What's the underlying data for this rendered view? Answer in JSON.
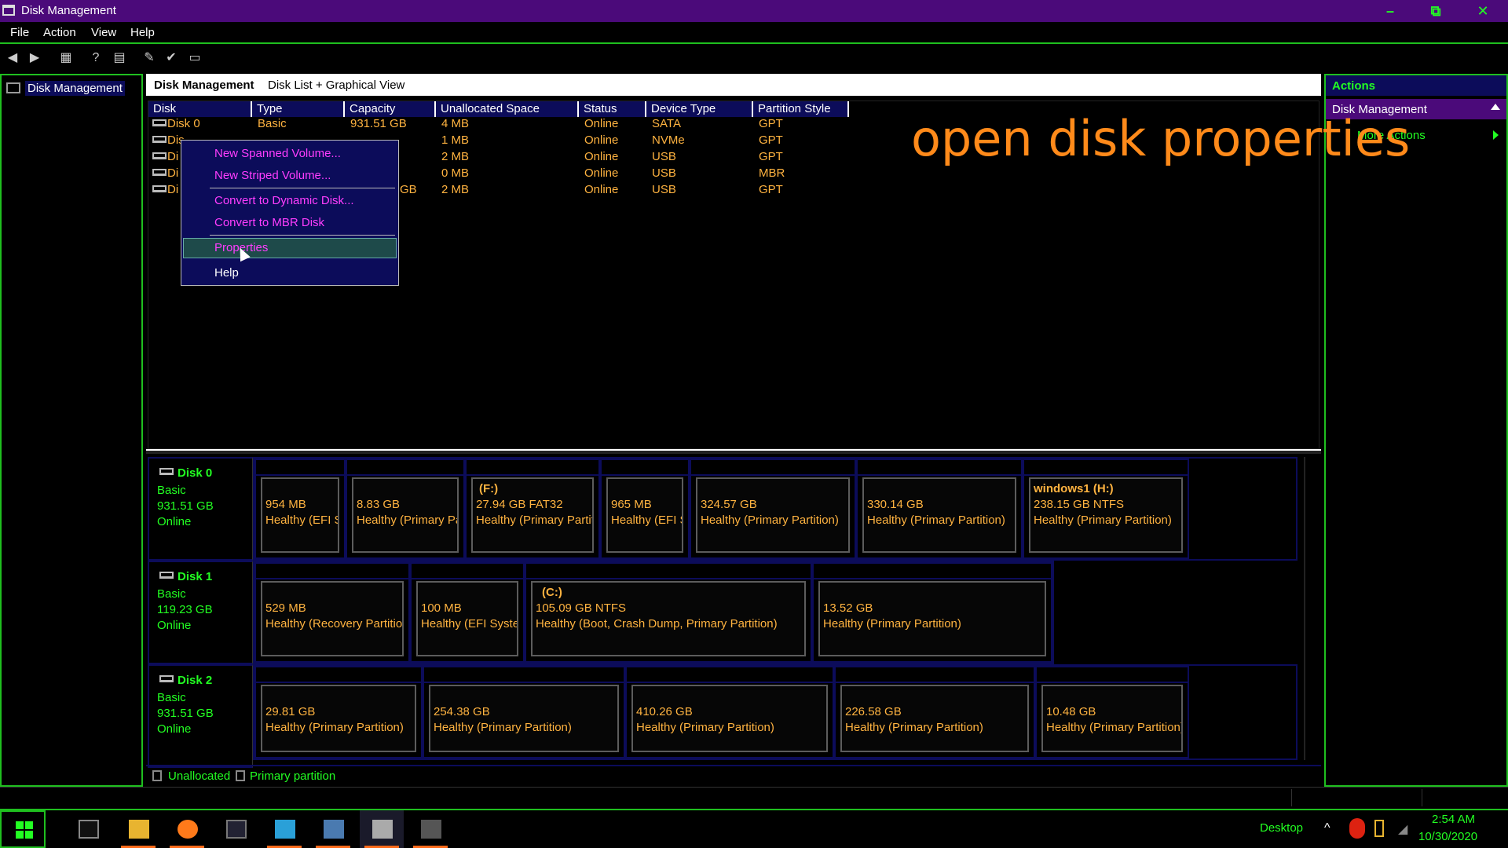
{
  "window": {
    "title": "Disk Management",
    "min": "–",
    "max": "⧉",
    "close": "✕"
  },
  "menu": [
    "File",
    "Action",
    "View",
    "Help"
  ],
  "tree": {
    "root": "Disk Management"
  },
  "center": {
    "title": "Disk Management",
    "view": "Disk List + Graphical View"
  },
  "list": {
    "headers": [
      "Disk",
      "Type",
      "Capacity",
      "Unallocated Space",
      "Status",
      "Device Type",
      "Partition Style"
    ],
    "rows": [
      {
        "disk": "Disk 0",
        "type": "Basic",
        "capacity": "931.51 GB",
        "unalloc": "4 MB",
        "status": "Online",
        "device": "SATA",
        "style": "GPT"
      },
      {
        "disk": "Dis",
        "type": "",
        "capacity": "",
        "unalloc": "1 MB",
        "status": "Online",
        "device": "NVMe",
        "style": "GPT"
      },
      {
        "disk": "Di",
        "type": "",
        "capacity": "",
        "unalloc": "2 MB",
        "status": "Online",
        "device": "USB",
        "style": "GPT"
      },
      {
        "disk": "Di",
        "type": "",
        "capacity": "",
        "unalloc": "0 MB",
        "status": "Online",
        "device": "USB",
        "style": "MBR"
      },
      {
        "disk": "Di",
        "type": "",
        "capacity": "GB",
        "unalloc": "2 MB",
        "status": "Online",
        "device": "USB",
        "style": "GPT"
      }
    ]
  },
  "context_menu": {
    "items": [
      "New Spanned Volume...",
      "New Striped Volume...",
      "Convert to Dynamic Disk...",
      "Convert to MBR Disk",
      "Properties",
      "Help"
    ]
  },
  "caption": "open disk properties",
  "graph": {
    "disks": [
      {
        "name": "Disk 0",
        "type": "Basic",
        "size": "931.51 GB",
        "status": "Online",
        "parts": [
          {
            "title": "",
            "size": "954 MB",
            "health": "Healthy (EFI Sy"
          },
          {
            "title": "",
            "size": "8.83 GB",
            "health": "Healthy (Primary Pa"
          },
          {
            "title": "(F:)",
            "size": "27.94 GB FAT32",
            "health": "Healthy (Primary Partiti"
          },
          {
            "title": "",
            "size": "965 MB",
            "health": "Healthy (EFI Sy"
          },
          {
            "title": "",
            "size": "324.57 GB",
            "health": "Healthy (Primary Partition)"
          },
          {
            "title": "",
            "size": "330.14 GB",
            "health": "Healthy (Primary Partition)"
          },
          {
            "title": "windows1  (H:)",
            "size": "238.15 GB NTFS",
            "health": "Healthy (Primary Partition)"
          }
        ]
      },
      {
        "name": "Disk 1",
        "type": "Basic",
        "size": "119.23 GB",
        "status": "Online",
        "parts": [
          {
            "title": "",
            "size": "529 MB",
            "health": "Healthy (Recovery Partition"
          },
          {
            "title": "",
            "size": "100 MB",
            "health": "Healthy (EFI System"
          },
          {
            "title": "(C:)",
            "size": "105.09 GB NTFS",
            "health": "Healthy (Boot, Crash Dump, Primary Partition)"
          },
          {
            "title": "",
            "size": "13.52 GB",
            "health": "Healthy (Primary Partition)"
          }
        ]
      },
      {
        "name": "Disk 2",
        "type": "Basic",
        "size": "931.51 GB",
        "status": "Online",
        "parts": [
          {
            "title": "",
            "size": "29.81 GB",
            "health": "Healthy (Primary Partition)"
          },
          {
            "title": "",
            "size": "254.38 GB",
            "health": "Healthy (Primary Partition)"
          },
          {
            "title": "",
            "size": "410.26 GB",
            "health": "Healthy (Primary Partition)"
          },
          {
            "title": "",
            "size": "226.58 GB",
            "health": "Healthy (Primary Partition)"
          },
          {
            "title": "",
            "size": "10.48 GB",
            "health": "Healthy (Primary Partition)"
          }
        ]
      }
    ],
    "legend": [
      "Unallocated",
      "Primary partition"
    ]
  },
  "actions": {
    "header": "Actions",
    "section": "Disk Management",
    "more": "More Actions"
  },
  "taskbar": {
    "desktop": "Desktop",
    "time": "2:54 AM",
    "date": "10/30/2020"
  },
  "colors": {
    "accent": "#22ff22",
    "title_bg": "#4b0a7a",
    "highlight": "#0c0c5a",
    "data_text": "#ffb340",
    "menu_text": "#ff3dff",
    "caption": "#ff8a1a"
  }
}
